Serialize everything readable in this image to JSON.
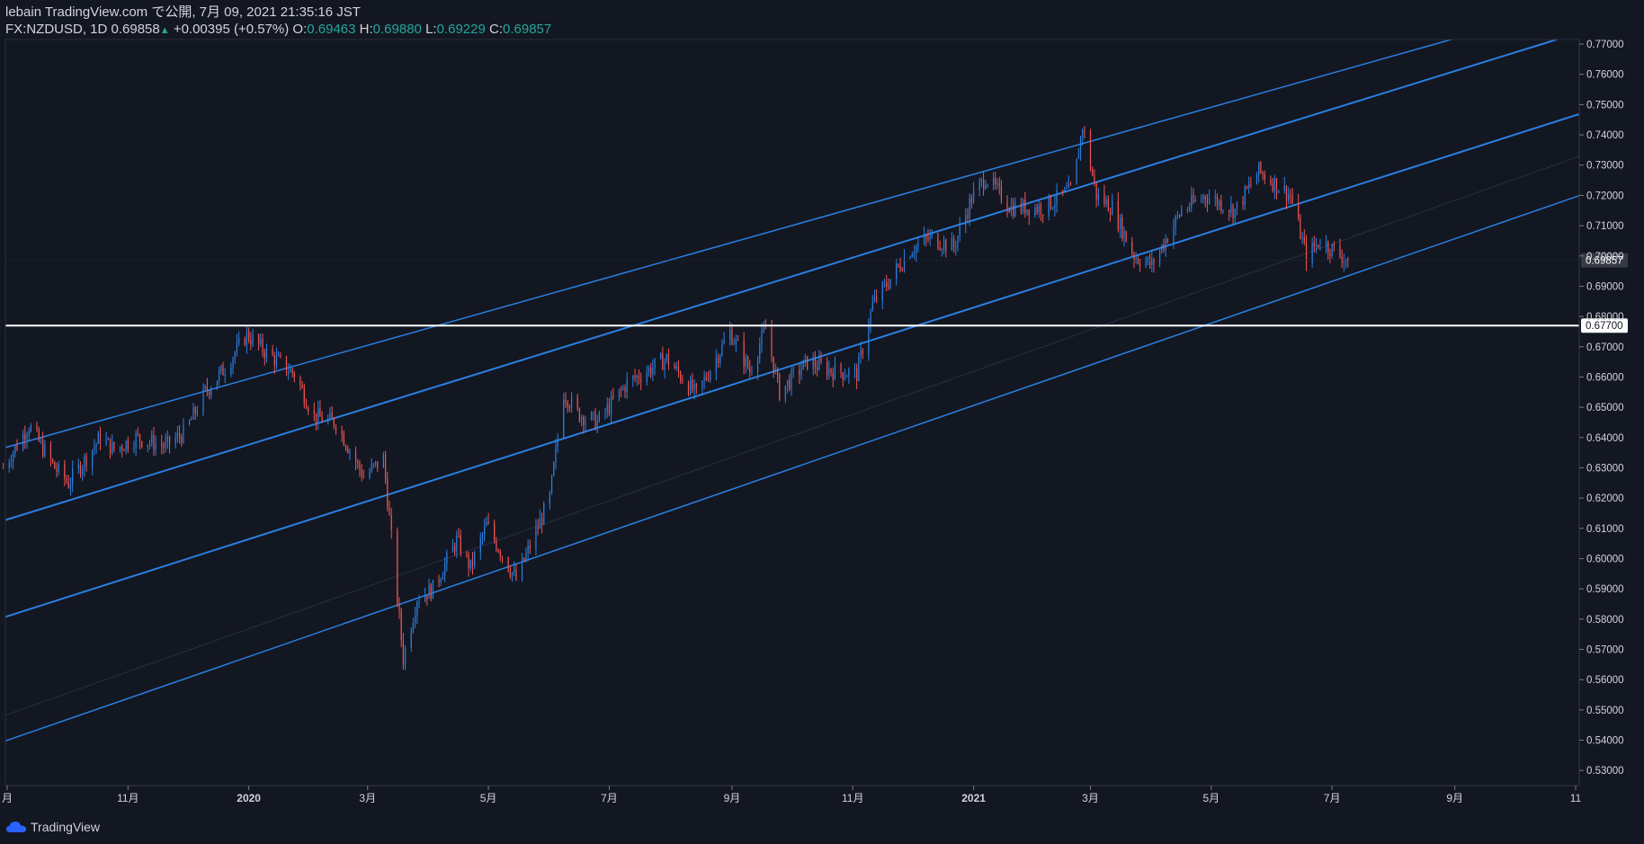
{
  "header": {
    "publisher": "lebain TradingView.com で公開, 7月 09, 2021 21:35:16 JST",
    "symbol": "FX:NZDUSD, 1D",
    "last": "0.69858",
    "arrow": "▲",
    "change": "+0.00395 (+0.57%)",
    "o_label": "O:",
    "o_val": "0.69463",
    "h_label": "H:",
    "h_val": "0.69880",
    "l_label": "L:",
    "l_val": "0.69229",
    "c_label": "C:",
    "c_val": "0.69857"
  },
  "footer": {
    "brand": "TradingView"
  },
  "colors": {
    "background": "#131722",
    "up": "#2a7fe0",
    "down": "#ef5350",
    "channel": "#2a7fe0",
    "hline": "#ffffff",
    "text": "#d1d4dc",
    "green": "#26a69a"
  },
  "chart_data": {
    "type": "candlestick",
    "symbol": "FX:NZDUSD",
    "interval": "1D",
    "ylim": [
      0.525,
      0.7715
    ],
    "y_ticks": [
      "0.77000",
      "0.76000",
      "0.75000",
      "0.74000",
      "0.73000",
      "0.72000",
      "0.71000",
      "0.70000",
      "0.69000",
      "0.68000",
      "0.67000",
      "0.66000",
      "0.65000",
      "0.64000",
      "0.63000",
      "0.62000",
      "0.61000",
      "0.60000",
      "0.59000",
      "0.58000",
      "0.57000",
      "0.56000",
      "0.55000",
      "0.54000",
      "0.53000"
    ],
    "x_ticks": [
      "月",
      "11月",
      "2020",
      "3月",
      "5月",
      "7月",
      "9月",
      "11月",
      "2021",
      "3月",
      "5月",
      "7月",
      "9月",
      "11"
    ],
    "x_tick_dates": [
      "2019-09-01",
      "2019-11-01",
      "2020-01-01",
      "2020-03-01",
      "2020-05-01",
      "2020-07-01",
      "2020-09-01",
      "2020-11-01",
      "2021-01-01",
      "2021-03-01",
      "2021-05-01",
      "2021-07-01",
      "2021-09-01",
      "2021-11-01"
    ],
    "last_price_label": "0.69857",
    "hline_price": 0.677,
    "hline_label": "0.67700",
    "keypoints": [
      [
        "2019-08-30",
        0.63
      ],
      [
        "2019-09-12",
        0.644
      ],
      [
        "2019-09-25",
        0.63
      ],
      [
        "2019-10-02",
        0.625
      ],
      [
        "2019-10-18",
        0.64
      ],
      [
        "2019-10-25",
        0.636
      ],
      [
        "2019-11-05",
        0.64
      ],
      [
        "2019-11-20",
        0.637
      ],
      [
        "2019-11-30",
        0.642
      ],
      [
        "2019-12-10",
        0.655
      ],
      [
        "2019-12-20",
        0.663
      ],
      [
        "2019-12-31",
        0.674
      ],
      [
        "2020-01-10",
        0.668
      ],
      [
        "2020-01-24",
        0.661
      ],
      [
        "2020-02-03",
        0.647
      ],
      [
        "2020-02-14",
        0.645
      ],
      [
        "2020-02-28",
        0.627
      ],
      [
        "2020-03-09",
        0.633
      ],
      [
        "2020-03-19",
        0.567
      ],
      [
        "2020-03-26",
        0.587
      ],
      [
        "2020-04-03",
        0.59
      ],
      [
        "2020-04-15",
        0.606
      ],
      [
        "2020-04-22",
        0.597
      ],
      [
        "2020-04-30",
        0.611
      ],
      [
        "2020-05-15",
        0.593
      ],
      [
        "2020-06-01",
        0.62
      ],
      [
        "2020-06-08",
        0.655
      ],
      [
        "2020-06-15",
        0.648
      ],
      [
        "2020-06-25",
        0.645
      ],
      [
        "2020-07-10",
        0.658
      ],
      [
        "2020-07-30",
        0.666
      ],
      [
        "2020-08-14",
        0.654
      ],
      [
        "2020-08-31",
        0.675
      ],
      [
        "2020-09-10",
        0.662
      ],
      [
        "2020-09-18",
        0.676
      ],
      [
        "2020-09-25",
        0.655
      ],
      [
        "2020-10-09",
        0.665
      ],
      [
        "2020-10-22",
        0.662
      ],
      [
        "2020-11-03",
        0.661
      ],
      [
        "2020-11-11",
        0.684
      ],
      [
        "2020-11-30",
        0.702
      ],
      [
        "2020-12-10",
        0.706
      ],
      [
        "2020-12-22",
        0.703
      ],
      [
        "2020-12-31",
        0.719
      ],
      [
        "2021-01-07",
        0.726
      ],
      [
        "2021-01-20",
        0.716
      ],
      [
        "2021-02-05",
        0.716
      ],
      [
        "2021-02-20",
        0.722
      ],
      [
        "2021-02-25",
        0.743
      ],
      [
        "2021-03-04",
        0.72
      ],
      [
        "2021-03-12",
        0.716
      ],
      [
        "2021-03-23",
        0.7
      ],
      [
        "2021-04-01",
        0.697
      ],
      [
        "2021-04-16",
        0.715
      ],
      [
        "2021-04-28",
        0.72
      ],
      [
        "2021-05-13",
        0.715
      ],
      [
        "2021-05-25",
        0.728
      ],
      [
        "2021-06-10",
        0.72
      ],
      [
        "2021-06-18",
        0.7
      ],
      [
        "2021-06-25",
        0.705
      ],
      [
        "2021-07-09",
        0.6986
      ]
    ],
    "channels": [
      {
        "name": "upper",
        "p1": [
          "2019-08-30",
          0.6365
        ],
        "p2": [
          "2021-08-22",
          0.77
        ],
        "width": 1.5
      },
      {
        "name": "mid-upper",
        "p1": [
          "2019-08-30",
          0.6125
        ],
        "p2": [
          "2021-10-15",
          0.77
        ],
        "width": 2
      },
      {
        "name": "mid-lower",
        "p1": [
          "2019-08-30",
          0.5805
        ],
        "p2": [
          "2021-11-01",
          0.7465
        ],
        "width": 2
      },
      {
        "name": "faint",
        "p1": [
          "2019-08-30",
          0.548
        ],
        "p2": [
          "2021-11-01",
          0.7325
        ],
        "width": 0.8,
        "faint": true
      },
      {
        "name": "lower",
        "p1": [
          "2019-08-30",
          0.5395
        ],
        "p2": [
          "2021-11-01",
          0.7195
        ],
        "width": 1.5
      }
    ]
  }
}
